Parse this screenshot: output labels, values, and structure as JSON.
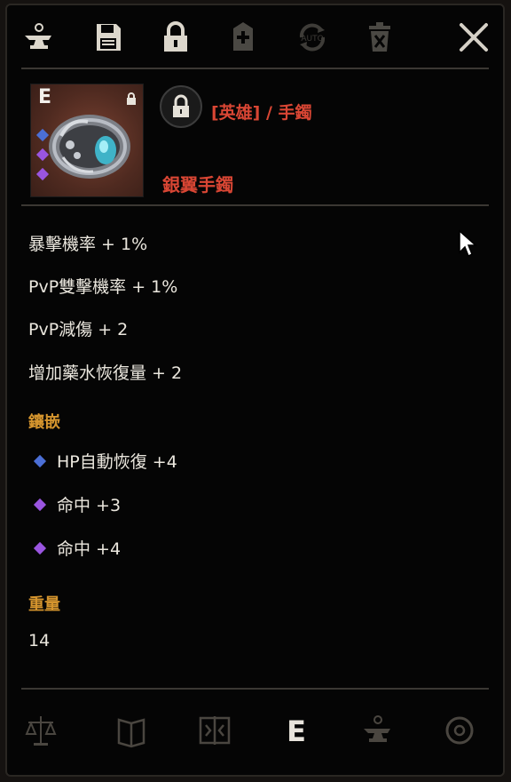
{
  "item": {
    "grade": "E",
    "type_label": "[英雄] / 手鐲",
    "name": "銀翼手鐲"
  },
  "stats": [
    "暴擊機率 + 1%",
    "PvP雙擊機率 + 1%",
    "PvP減傷 + 2",
    "增加藥水恢復量 + 2"
  ],
  "inlay": {
    "title": "鑲嵌",
    "gems": [
      {
        "label": "HP自動恢復 +4",
        "color": "#4b6fd6"
      },
      {
        "label": "命中 +3",
        "color": "#9a55e0"
      },
      {
        "label": "命中 +4",
        "color": "#9a55e0"
      }
    ]
  },
  "weight": {
    "title": "重量",
    "value": "14"
  },
  "toolbar_icons": [
    "anvil-icon",
    "save-icon",
    "lock-icon",
    "add-tag-icon",
    "auto-icon",
    "delete-icon",
    "close-icon"
  ],
  "bottom_icons": [
    "scales-icon",
    "book-icon",
    "compare-icon",
    "grade-e-icon",
    "anvil-icon",
    "swirl-icon"
  ],
  "bottom_grade_label": "E",
  "colors": {
    "accent_red": "#d94634",
    "section_gold": "#d5952e",
    "gem_blue": "#4b6fd6",
    "gem_purple": "#9a55e0"
  }
}
